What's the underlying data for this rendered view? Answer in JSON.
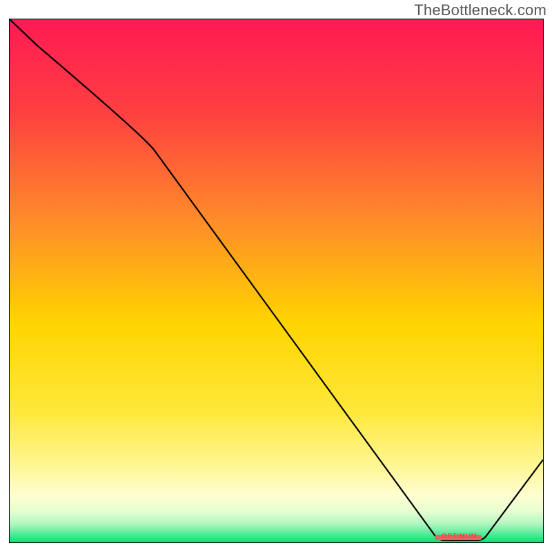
{
  "watermark": "TheBottleneck.com",
  "optimum_label": "OPTIMUM",
  "colors": {
    "grad_top": "#ff1a55",
    "grad_upper": "#ff6a2a",
    "grad_mid": "#ffd400",
    "grad_yellow_light": "#fff370",
    "grad_pale": "#ffffcc",
    "grad_green": "#00e676",
    "line": "#000000",
    "marker": "#e06666"
  },
  "chart_data": {
    "type": "line",
    "title": "",
    "xlabel": "",
    "ylabel": "",
    "xlim": [
      0,
      100
    ],
    "ylim": [
      0,
      100
    ],
    "x": [
      0,
      25,
      80,
      88,
      100
    ],
    "values": [
      100,
      78,
      0,
      0,
      16
    ],
    "optimum_range_x": [
      80,
      88
    ],
    "annotations": [
      "OPTIMUM"
    ]
  }
}
